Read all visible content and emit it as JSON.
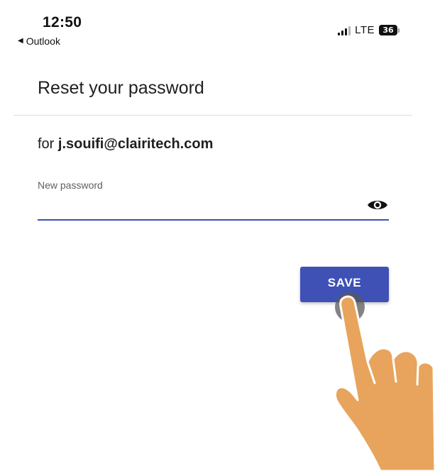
{
  "status_bar": {
    "time": "12:50",
    "back_app": "Outlook",
    "network": "LTE",
    "battery": "36",
    "battery_level_fraction": 0.36,
    "icons": [
      "back-triangle-icon",
      "signal-bars-icon",
      "battery-icon"
    ]
  },
  "header": {
    "title": "Reset your password"
  },
  "form": {
    "for_prefix": "for ",
    "email": "j.souifi@clairitech.com",
    "new_password_label": "New password",
    "new_password_value": "",
    "visibility_icon": "eye-icon",
    "save_label": "SAVE"
  },
  "colors": {
    "accent": "#3f51b5",
    "hand": "#e8a45c",
    "tap_indicator": "#5a5a5a"
  }
}
